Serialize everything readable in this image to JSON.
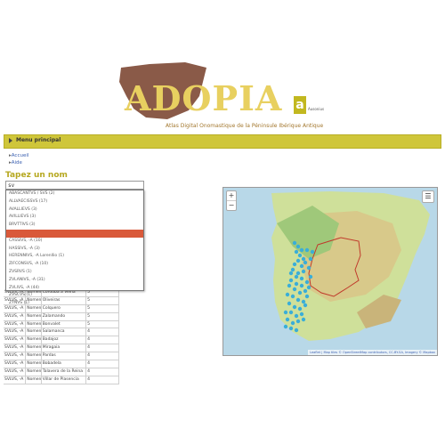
{
  "header": {
    "logo_text": "ADOPIA",
    "subtitle": "Atlas Digital Onomastique de la Péninsule Ibérique Antique",
    "badge_letter": "a",
    "badge_text": "Ausonius"
  },
  "menubar": {
    "label": "Menu principal"
  },
  "nav": {
    "items": [
      "Accueil",
      "Aide"
    ]
  },
  "search": {
    "heading": "Tapez un nom",
    "value": "sv"
  },
  "autocomplete": {
    "items": [
      "ABASCANTVS / SVS (2)",
      "ALLVAECISSVS (17)",
      "AVALLIEVS (3)",
      "AVILLIEVS (3)",
      "BRVTTIVS (3)",
      "",
      "CASSIVS, -A (10)",
      "HASSIVS, -A (3)",
      "HERENNIVS, -A Lorenllio (1)",
      "ZIFCONSVS, -A (10)",
      "ZVSRVS (1)",
      "ZVLANIVS, -A (31)",
      "ZVLIVS, -A (44)",
      "ZVSCVS (1)",
      "ZYNVS (1)"
    ],
    "highlight_index": 5
  },
  "results": {
    "rows": [
      [
        "SVLVS, -A",
        "Nomen",
        "Cordoba a Velha",
        "5"
      ],
      [
        "SVLVS, -A",
        "Nomen",
        "Oliveiras",
        "5"
      ],
      [
        "SVLVS, -A",
        "Nomen",
        "Colquero",
        "5"
      ],
      [
        "SVLVS, -A",
        "Nomen",
        "Zalamando",
        "5"
      ],
      [
        "SVLVS, -A",
        "Nomen",
        "Bonvalet",
        "5"
      ],
      [
        "SVLVS, -A",
        "Nomen",
        "Salamanca",
        "4"
      ],
      [
        "SVLVS, -A",
        "Nomen",
        "Badajoz",
        "4"
      ],
      [
        "SVLVS, -A",
        "Nomen",
        "Miragaia",
        "4"
      ],
      [
        "SVLVS, -A",
        "Nomen",
        "Pardas",
        "4"
      ],
      [
        "SVLVS, -A",
        "Nomen",
        "Bobadela",
        "4"
      ],
      [
        "SVLVS, -A",
        "Nomen",
        "Talavera de la Reina",
        "4"
      ],
      [
        "SVLVS, -A",
        "Nomen",
        "Villar de Plasencia",
        "4"
      ]
    ]
  },
  "map": {
    "zoom_in": "+",
    "zoom_out": "−",
    "layers_icon": "layers-icon",
    "attribution": "Leaflet | Map tiles © OpenStreetMap contributors, CC-BY-SA, Imagery © Mapbox"
  },
  "colors": {
    "accent": "#cfc63a",
    "marker": "#3aaed8",
    "boundary": "#c0392b",
    "highlight": "#d9593a"
  }
}
